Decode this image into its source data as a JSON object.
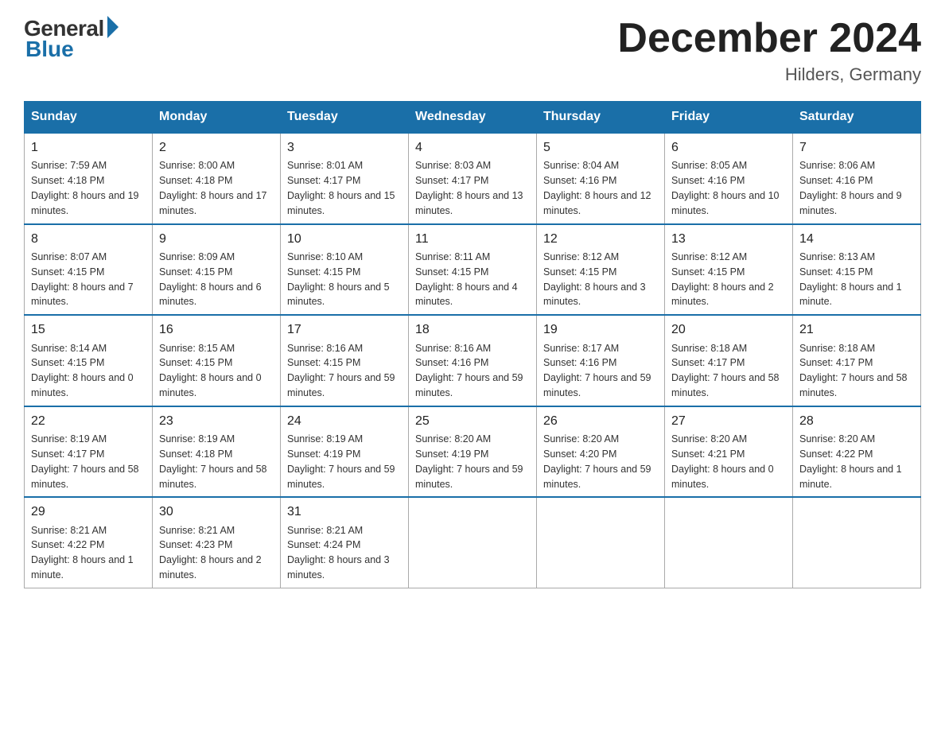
{
  "logo": {
    "general": "General",
    "blue": "Blue"
  },
  "title": "December 2024",
  "subtitle": "Hilders, Germany",
  "days_header": [
    "Sunday",
    "Monday",
    "Tuesday",
    "Wednesday",
    "Thursday",
    "Friday",
    "Saturday"
  ],
  "weeks": [
    [
      {
        "day": "1",
        "sunrise": "7:59 AM",
        "sunset": "4:18 PM",
        "daylight": "8 hours and 19 minutes."
      },
      {
        "day": "2",
        "sunrise": "8:00 AM",
        "sunset": "4:18 PM",
        "daylight": "8 hours and 17 minutes."
      },
      {
        "day": "3",
        "sunrise": "8:01 AM",
        "sunset": "4:17 PM",
        "daylight": "8 hours and 15 minutes."
      },
      {
        "day": "4",
        "sunrise": "8:03 AM",
        "sunset": "4:17 PM",
        "daylight": "8 hours and 13 minutes."
      },
      {
        "day": "5",
        "sunrise": "8:04 AM",
        "sunset": "4:16 PM",
        "daylight": "8 hours and 12 minutes."
      },
      {
        "day": "6",
        "sunrise": "8:05 AM",
        "sunset": "4:16 PM",
        "daylight": "8 hours and 10 minutes."
      },
      {
        "day": "7",
        "sunrise": "8:06 AM",
        "sunset": "4:16 PM",
        "daylight": "8 hours and 9 minutes."
      }
    ],
    [
      {
        "day": "8",
        "sunrise": "8:07 AM",
        "sunset": "4:15 PM",
        "daylight": "8 hours and 7 minutes."
      },
      {
        "day": "9",
        "sunrise": "8:09 AM",
        "sunset": "4:15 PM",
        "daylight": "8 hours and 6 minutes."
      },
      {
        "day": "10",
        "sunrise": "8:10 AM",
        "sunset": "4:15 PM",
        "daylight": "8 hours and 5 minutes."
      },
      {
        "day": "11",
        "sunrise": "8:11 AM",
        "sunset": "4:15 PM",
        "daylight": "8 hours and 4 minutes."
      },
      {
        "day": "12",
        "sunrise": "8:12 AM",
        "sunset": "4:15 PM",
        "daylight": "8 hours and 3 minutes."
      },
      {
        "day": "13",
        "sunrise": "8:12 AM",
        "sunset": "4:15 PM",
        "daylight": "8 hours and 2 minutes."
      },
      {
        "day": "14",
        "sunrise": "8:13 AM",
        "sunset": "4:15 PM",
        "daylight": "8 hours and 1 minute."
      }
    ],
    [
      {
        "day": "15",
        "sunrise": "8:14 AM",
        "sunset": "4:15 PM",
        "daylight": "8 hours and 0 minutes."
      },
      {
        "day": "16",
        "sunrise": "8:15 AM",
        "sunset": "4:15 PM",
        "daylight": "8 hours and 0 minutes."
      },
      {
        "day": "17",
        "sunrise": "8:16 AM",
        "sunset": "4:15 PM",
        "daylight": "7 hours and 59 minutes."
      },
      {
        "day": "18",
        "sunrise": "8:16 AM",
        "sunset": "4:16 PM",
        "daylight": "7 hours and 59 minutes."
      },
      {
        "day": "19",
        "sunrise": "8:17 AM",
        "sunset": "4:16 PM",
        "daylight": "7 hours and 59 minutes."
      },
      {
        "day": "20",
        "sunrise": "8:18 AM",
        "sunset": "4:17 PM",
        "daylight": "7 hours and 58 minutes."
      },
      {
        "day": "21",
        "sunrise": "8:18 AM",
        "sunset": "4:17 PM",
        "daylight": "7 hours and 58 minutes."
      }
    ],
    [
      {
        "day": "22",
        "sunrise": "8:19 AM",
        "sunset": "4:17 PM",
        "daylight": "7 hours and 58 minutes."
      },
      {
        "day": "23",
        "sunrise": "8:19 AM",
        "sunset": "4:18 PM",
        "daylight": "7 hours and 58 minutes."
      },
      {
        "day": "24",
        "sunrise": "8:19 AM",
        "sunset": "4:19 PM",
        "daylight": "7 hours and 59 minutes."
      },
      {
        "day": "25",
        "sunrise": "8:20 AM",
        "sunset": "4:19 PM",
        "daylight": "7 hours and 59 minutes."
      },
      {
        "day": "26",
        "sunrise": "8:20 AM",
        "sunset": "4:20 PM",
        "daylight": "7 hours and 59 minutes."
      },
      {
        "day": "27",
        "sunrise": "8:20 AM",
        "sunset": "4:21 PM",
        "daylight": "8 hours and 0 minutes."
      },
      {
        "day": "28",
        "sunrise": "8:20 AM",
        "sunset": "4:22 PM",
        "daylight": "8 hours and 1 minute."
      }
    ],
    [
      {
        "day": "29",
        "sunrise": "8:21 AM",
        "sunset": "4:22 PM",
        "daylight": "8 hours and 1 minute."
      },
      {
        "day": "30",
        "sunrise": "8:21 AM",
        "sunset": "4:23 PM",
        "daylight": "8 hours and 2 minutes."
      },
      {
        "day": "31",
        "sunrise": "8:21 AM",
        "sunset": "4:24 PM",
        "daylight": "8 hours and 3 minutes."
      },
      null,
      null,
      null,
      null
    ]
  ]
}
